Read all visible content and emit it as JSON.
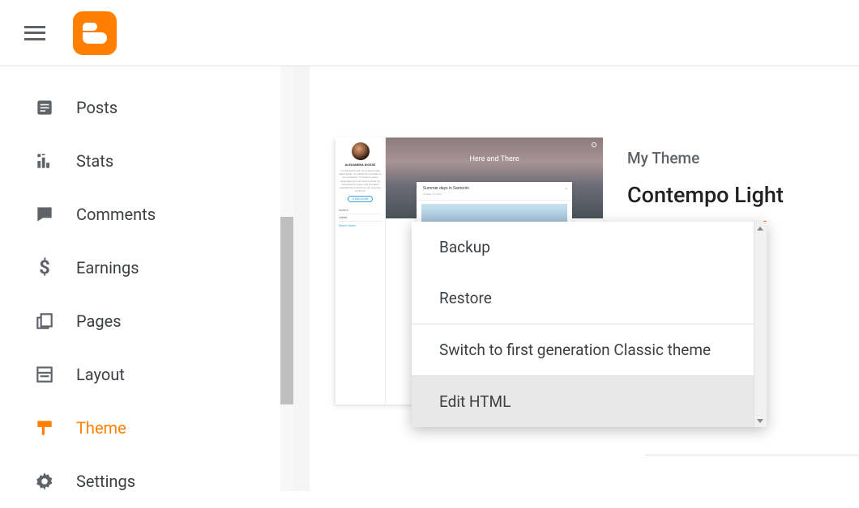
{
  "sidebar": {
    "items": [
      {
        "label": "Posts",
        "icon": "posts-icon",
        "active": false
      },
      {
        "label": "Stats",
        "icon": "stats-icon",
        "active": false
      },
      {
        "label": "Comments",
        "icon": "comments-icon",
        "active": false
      },
      {
        "label": "Earnings",
        "icon": "earnings-icon",
        "active": false
      },
      {
        "label": "Pages",
        "icon": "pages-icon",
        "active": false
      },
      {
        "label": "Layout",
        "icon": "layout-icon",
        "active": false
      },
      {
        "label": "Theme",
        "icon": "theme-icon",
        "active": true
      },
      {
        "label": "Settings",
        "icon": "settings-icon",
        "active": false
      }
    ]
  },
  "theme": {
    "section_label": "My Theme",
    "name": "Contempo Light"
  },
  "preview": {
    "author_name": "ALEXANDRA KIOSSE",
    "hero_title": "Here and There",
    "post_title": "Summer days in Santorini",
    "post_date": "October 16, 2016",
    "archive_label": "Archive",
    "labels_label": "Labels",
    "report_label": "Report Abuse"
  },
  "dropdown": {
    "items": [
      {
        "label": "Backup"
      },
      {
        "label": "Restore"
      },
      {
        "label": "Switch to first generation Classic theme"
      },
      {
        "label": "Edit HTML",
        "hover": true
      }
    ]
  },
  "colors": {
    "accent": "#ff8000",
    "text": "#3c4043",
    "muted": "#5f6368"
  }
}
